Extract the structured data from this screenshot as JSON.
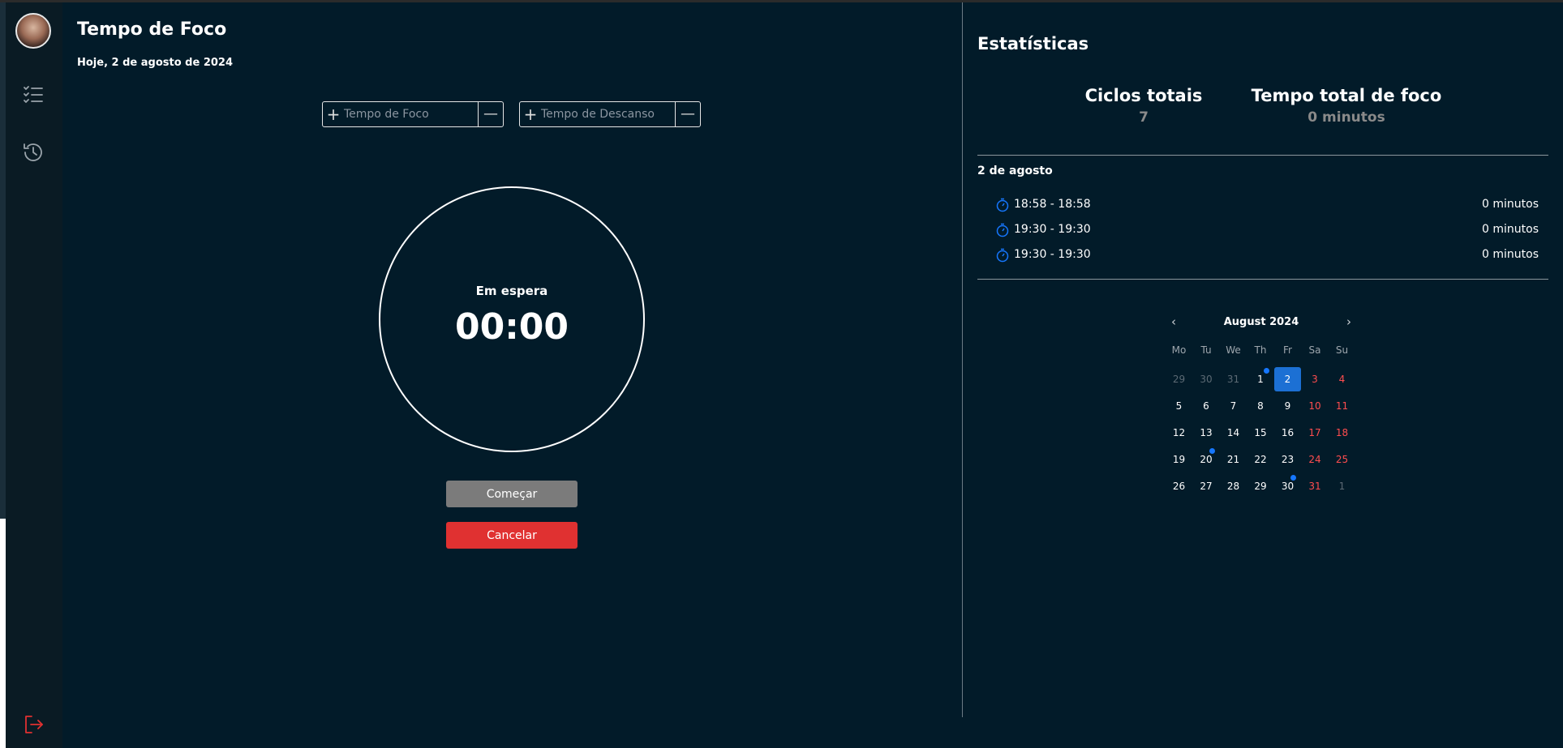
{
  "header": {
    "title": "Tempo de Foco",
    "date": "Hoje, 2 de agosto de 2024"
  },
  "sidebar": {
    "items": [
      {
        "icon": "checklist-icon"
      },
      {
        "icon": "history-icon"
      }
    ],
    "logout_icon": "logout-icon"
  },
  "steppers": {
    "focus_placeholder": "Tempo de Foco",
    "rest_placeholder": "Tempo de Descanso",
    "plus": "+",
    "minus": "—"
  },
  "timer": {
    "status": "Em espera",
    "time": "00:00"
  },
  "buttons": {
    "start": "Começar",
    "cancel": "Cancelar"
  },
  "stats": {
    "title": "Estatísticas",
    "cycles_label": "Ciclos totais",
    "cycles_value": "7",
    "focus_label": "Tempo total de foco",
    "focus_value": "0 minutos",
    "day_heading": "2 de agosto",
    "sessions": [
      {
        "range": "18:58 - 18:58",
        "duration": "0 minutos"
      },
      {
        "range": "19:30 - 19:30",
        "duration": "0 minutos"
      },
      {
        "range": "19:30 - 19:30",
        "duration": "0 minutos"
      }
    ]
  },
  "calendar": {
    "month": "August 2024",
    "prev": "‹",
    "next": "›",
    "weekdays": [
      "Mo",
      "Tu",
      "We",
      "Th",
      "Fr",
      "Sa",
      "Su"
    ],
    "weeks": [
      [
        {
          "d": "29",
          "out": true
        },
        {
          "d": "30",
          "out": true
        },
        {
          "d": "31",
          "out": true
        },
        {
          "d": "1",
          "dot": true
        },
        {
          "d": "2",
          "sel": true
        },
        {
          "d": "3",
          "we": true
        },
        {
          "d": "4",
          "we": true
        }
      ],
      [
        {
          "d": "5"
        },
        {
          "d": "6"
        },
        {
          "d": "7"
        },
        {
          "d": "8"
        },
        {
          "d": "9"
        },
        {
          "d": "10",
          "we": true
        },
        {
          "d": "11",
          "we": true
        }
      ],
      [
        {
          "d": "12"
        },
        {
          "d": "13"
        },
        {
          "d": "14"
        },
        {
          "d": "15"
        },
        {
          "d": "16"
        },
        {
          "d": "17",
          "we": true
        },
        {
          "d": "18",
          "we": true
        }
      ],
      [
        {
          "d": "19"
        },
        {
          "d": "20",
          "dot": true
        },
        {
          "d": "21"
        },
        {
          "d": "22"
        },
        {
          "d": "23"
        },
        {
          "d": "24",
          "we": true
        },
        {
          "d": "25",
          "we": true
        }
      ],
      [
        {
          "d": "26"
        },
        {
          "d": "27"
        },
        {
          "d": "28"
        },
        {
          "d": "29"
        },
        {
          "d": "30",
          "dot": true
        },
        {
          "d": "31",
          "we": true
        },
        {
          "d": "1",
          "out": true
        }
      ]
    ]
  },
  "colors": {
    "background": "#021b29",
    "sidebar": "#0a1b24",
    "accent": "#1677ff",
    "danger": "#e03131",
    "weekend": "#ff4d4f"
  }
}
